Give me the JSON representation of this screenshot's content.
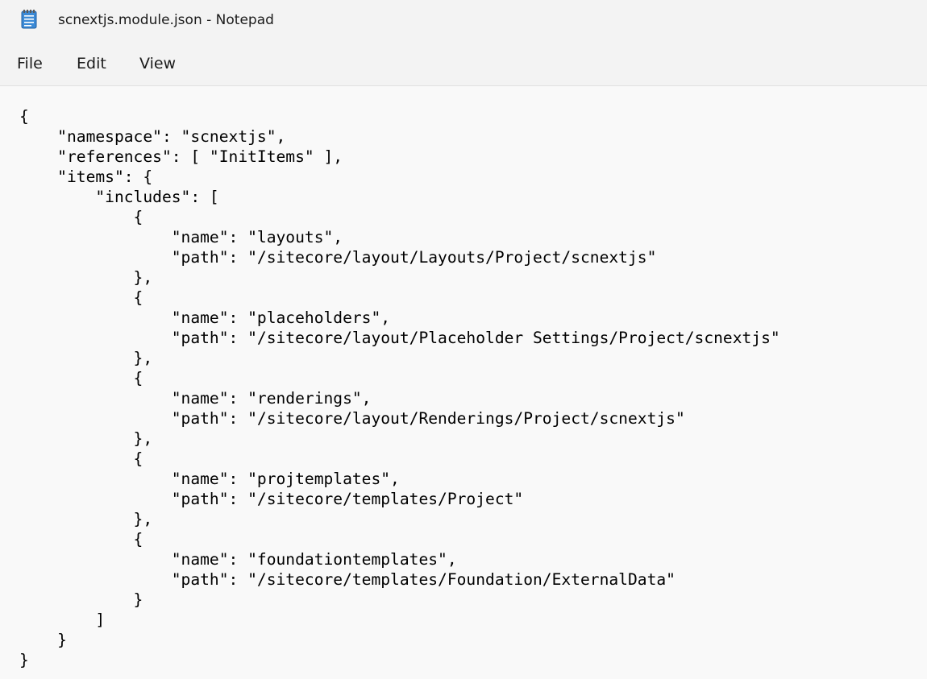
{
  "window": {
    "title": "scnextjs.module.json - Notepad",
    "icon": "notepad-icon"
  },
  "menu": {
    "file": "File",
    "edit": "Edit",
    "view": "View"
  },
  "editor": {
    "content": "{\n    \"namespace\": \"scnextjs\",\n    \"references\": [ \"InitItems\" ],\n    \"items\": {\n        \"includes\": [\n            {\n                \"name\": \"layouts\",\n                \"path\": \"/sitecore/layout/Layouts/Project/scnextjs\"\n            },\n            {\n                \"name\": \"placeholders\",\n                \"path\": \"/sitecore/layout/Placeholder Settings/Project/scnextjs\"\n            },\n            {\n                \"name\": \"renderings\",\n                \"path\": \"/sitecore/layout/Renderings/Project/scnextjs\"\n            },\n            {\n                \"name\": \"projtemplates\",\n                \"path\": \"/sitecore/templates/Project\"\n            },\n            {\n                \"name\": \"foundationtemplates\",\n                \"path\": \"/sitecore/templates/Foundation/ExternalData\"\n            }\n        ]\n    }\n}"
  },
  "colors": {
    "titlebar": "#f3f3f3",
    "editor_bg": "#f9f9f9",
    "icon_blue": "#2f7dc4",
    "text": "#000000"
  }
}
